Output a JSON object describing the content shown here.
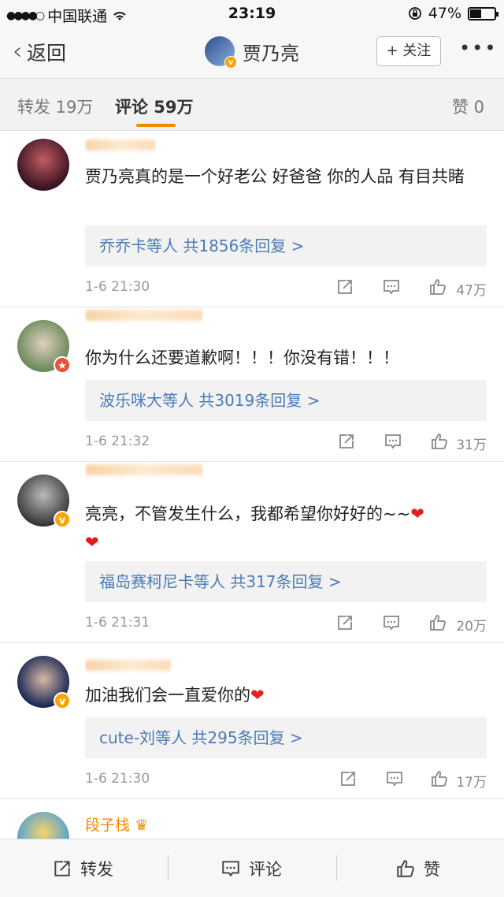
{
  "status_bar": {
    "carrier": "中国联通",
    "time": "23:19",
    "battery": "47%"
  },
  "nav": {
    "back_label": "返回",
    "title": "贾乃亮",
    "follow_label": "+ 关注",
    "more": "•••"
  },
  "tabs": {
    "repost": "转发 19万",
    "comment": "评论 59万",
    "like": "赞 0"
  },
  "comments": [
    {
      "text": "贾乃亮真的是一个好老公 好爸爸 你的人品 有目共睹",
      "replies": "乔乔卡等人 共1856条回复 >",
      "time": "1-6 21:30",
      "likes": "47万"
    },
    {
      "text": "你为什么还要道歉啊！！！你没有错！！！",
      "replies": "波乐咪大等人 共3019条回复 >",
      "time": "1-6 21:32",
      "likes": "31万"
    },
    {
      "text": "亮亮，不管发生什么，我都希望你好好的~~",
      "replies": "福岛赛柯尼卡等人 共317条回复 >",
      "time": "1-6 21:31",
      "likes": "20万"
    },
    {
      "text": "加油我们会一直爱你的",
      "replies": "cute-刘等人 共295条回复 >",
      "time": "1-6 21:30",
      "likes": "17万"
    },
    {
      "name": "段子栈"
    }
  ],
  "bottom_bar": {
    "repost": "转发",
    "comment": "评论",
    "like": "赞"
  },
  "colors": {
    "accent": "#f28b00",
    "link": "#4a7bb8",
    "verified": "#f7a400"
  }
}
